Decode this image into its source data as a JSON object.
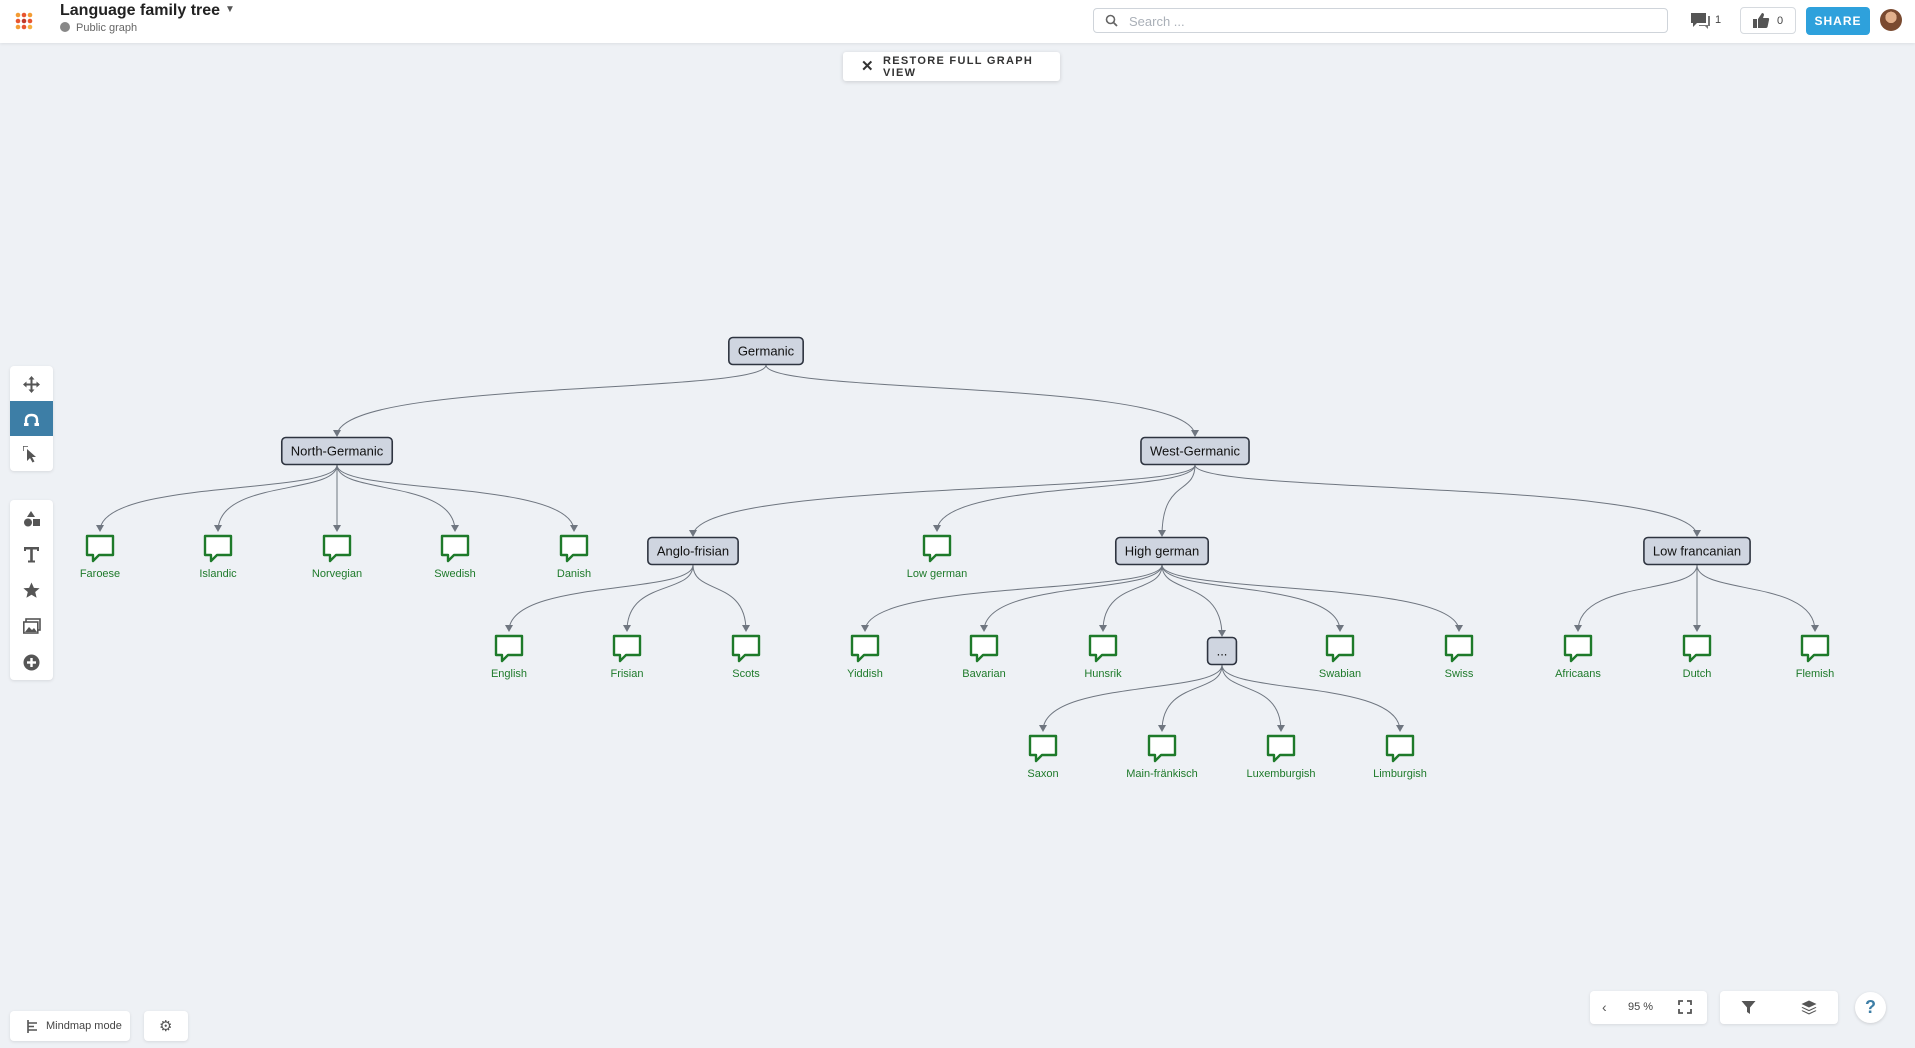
{
  "app": {
    "title": "Language family tree",
    "visibility": "Public graph"
  },
  "header": {
    "search_placeholder": "Search ...",
    "comments_count": "1",
    "likes_count": "0",
    "share_label": "SHARE"
  },
  "restore_view_label": "RESTORE FULL GRAPH VIEW",
  "toolbar_group_1": [
    "move-icon",
    "connect-icon",
    "select-icon"
  ],
  "toolbar_group_2": [
    "shapes-icon",
    "text-icon",
    "star-icon",
    "image-icon",
    "add-icon"
  ],
  "footer": {
    "mindmap_label": "Mindmap mode",
    "zoom": "95 %"
  },
  "colors": {
    "accent": "#2ea1dc",
    "active_tool": "#3d7ea6",
    "category_node": "#cfd5e0",
    "leaf_node": "#1e7a2a",
    "edge": "#6f7680"
  },
  "graph": {
    "nodes": [
      {
        "id": "germanic",
        "label": "Germanic",
        "kind": "category"
      },
      {
        "id": "north",
        "label": "North-Germanic",
        "kind": "category"
      },
      {
        "id": "west",
        "label": "West-Germanic",
        "kind": "category"
      },
      {
        "id": "faroese",
        "label": "Faroese",
        "kind": "leaf"
      },
      {
        "id": "islandic",
        "label": "Islandic",
        "kind": "leaf"
      },
      {
        "id": "norvegian",
        "label": "Norvegian",
        "kind": "leaf"
      },
      {
        "id": "swedish",
        "label": "Swedish",
        "kind": "leaf"
      },
      {
        "id": "danish",
        "label": "Danish",
        "kind": "leaf"
      },
      {
        "id": "anglofrisian",
        "label": "Anglo-frisian",
        "kind": "category"
      },
      {
        "id": "lowgerman",
        "label": "Low german",
        "kind": "leaf"
      },
      {
        "id": "highgerman",
        "label": "High german",
        "kind": "category"
      },
      {
        "id": "lowfrancanian",
        "label": "Low francanian",
        "kind": "category"
      },
      {
        "id": "english",
        "label": "English",
        "kind": "leaf"
      },
      {
        "id": "frisian",
        "label": "Frisian",
        "kind": "leaf"
      },
      {
        "id": "scots",
        "label": "Scots",
        "kind": "leaf"
      },
      {
        "id": "yiddish",
        "label": "Yiddish",
        "kind": "leaf"
      },
      {
        "id": "bavarian",
        "label": "Bavarian",
        "kind": "leaf"
      },
      {
        "id": "hunsrik",
        "label": "Hunsrik",
        "kind": "leaf"
      },
      {
        "id": "more",
        "label": "...",
        "kind": "category"
      },
      {
        "id": "swabian",
        "label": "Swabian",
        "kind": "leaf"
      },
      {
        "id": "swiss",
        "label": "Swiss",
        "kind": "leaf"
      },
      {
        "id": "africaans",
        "label": "Africaans",
        "kind": "leaf"
      },
      {
        "id": "dutch",
        "label": "Dutch",
        "kind": "leaf"
      },
      {
        "id": "flemish",
        "label": "Flemish",
        "kind": "leaf"
      },
      {
        "id": "saxon",
        "label": "Saxon",
        "kind": "leaf"
      },
      {
        "id": "mainfrankisch",
        "label": "Main-fränkisch",
        "kind": "leaf"
      },
      {
        "id": "luxemburgish",
        "label": "Luxemburgish",
        "kind": "leaf"
      },
      {
        "id": "limburgish",
        "label": "Limburgish",
        "kind": "leaf"
      }
    ],
    "edges": [
      [
        "germanic",
        "north"
      ],
      [
        "germanic",
        "west"
      ],
      [
        "north",
        "faroese"
      ],
      [
        "north",
        "islandic"
      ],
      [
        "north",
        "norvegian"
      ],
      [
        "north",
        "swedish"
      ],
      [
        "north",
        "danish"
      ],
      [
        "west",
        "anglofrisian"
      ],
      [
        "west",
        "lowgerman"
      ],
      [
        "west",
        "highgerman"
      ],
      [
        "west",
        "lowfrancanian"
      ],
      [
        "anglofrisian",
        "english"
      ],
      [
        "anglofrisian",
        "frisian"
      ],
      [
        "anglofrisian",
        "scots"
      ],
      [
        "highgerman",
        "yiddish"
      ],
      [
        "highgerman",
        "bavarian"
      ],
      [
        "highgerman",
        "hunsrik"
      ],
      [
        "highgerman",
        "more"
      ],
      [
        "highgerman",
        "swabian"
      ],
      [
        "highgerman",
        "swiss"
      ],
      [
        "lowfrancanian",
        "africaans"
      ],
      [
        "lowfrancanian",
        "dutch"
      ],
      [
        "lowfrancanian",
        "flemish"
      ],
      [
        "more",
        "saxon"
      ],
      [
        "more",
        "mainfrankisch"
      ],
      [
        "more",
        "luxemburgish"
      ],
      [
        "more",
        "limburgish"
      ]
    ]
  }
}
